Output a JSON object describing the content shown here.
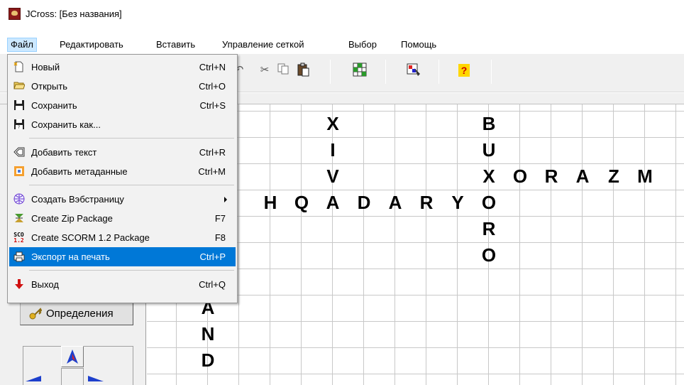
{
  "window": {
    "title": "JCross: [Без названия]"
  },
  "menubar": {
    "items": [
      {
        "label": "Файл"
      },
      {
        "label": "Редактировать"
      },
      {
        "label": "Вставить"
      },
      {
        "label": "Управление сеткой"
      },
      {
        "label": "Выбор"
      },
      {
        "label": "Помощь"
      }
    ]
  },
  "file_menu": {
    "items": [
      {
        "label": "Новый",
        "shortcut": "Ctrl+N",
        "icon": "new-document-icon"
      },
      {
        "label": "Открыть",
        "shortcut": "Ctrl+O",
        "icon": "folder-open-icon"
      },
      {
        "label": "Сохранить",
        "shortcut": "Ctrl+S",
        "icon": "floppy-disk-icon"
      },
      {
        "label": "Сохранить как...",
        "shortcut": "",
        "icon": "save-as-icon"
      },
      {
        "label": "Добавить текст",
        "shortcut": "Ctrl+R",
        "icon": "text-tag-icon"
      },
      {
        "label": "Добавить метаданные",
        "shortcut": "Ctrl+M",
        "icon": "metadata-icon"
      },
      {
        "label": "Создать Вэбстраницу",
        "shortcut": "",
        "icon": "web-page-icon"
      },
      {
        "label": "Create Zip Package",
        "shortcut": "F7",
        "icon": "zip-package-icon"
      },
      {
        "label": "Create SCORM 1.2 Package",
        "shortcut": "F8",
        "icon": "scorm-icon"
      },
      {
        "label": "Экспорт на печать",
        "shortcut": "Ctrl+P",
        "icon": "printer-icon"
      },
      {
        "label": "Выход",
        "shortcut": "Ctrl+Q",
        "icon": "exit-arrow-icon"
      }
    ],
    "scorm_badge_top": "SCO",
    "scorm_badge_bottom": "1.2"
  },
  "left_panel": {
    "definitions_button": "Определения"
  },
  "crossword": {
    "letters": [
      {
        "ch": "X",
        "col": 5,
        "row": 0
      },
      {
        "ch": "I",
        "col": 5,
        "row": 1
      },
      {
        "ch": "V",
        "col": 5,
        "row": 2
      },
      {
        "ch": "B",
        "col": 10,
        "row": 0
      },
      {
        "ch": "U",
        "col": 10,
        "row": 1
      },
      {
        "ch": "X",
        "col": 10,
        "row": 2
      },
      {
        "ch": "O",
        "col": 11,
        "row": 2
      },
      {
        "ch": "R",
        "col": 12,
        "row": 2
      },
      {
        "ch": "A",
        "col": 13,
        "row": 2
      },
      {
        "ch": "Z",
        "col": 14,
        "row": 2
      },
      {
        "ch": "M",
        "col": 15,
        "row": 2
      },
      {
        "ch": "H",
        "col": 3,
        "row": 3
      },
      {
        "ch": "Q",
        "col": 4,
        "row": 3
      },
      {
        "ch": "A",
        "col": 5,
        "row": 3
      },
      {
        "ch": "D",
        "col": 6,
        "row": 3
      },
      {
        "ch": "A",
        "col": 7,
        "row": 3
      },
      {
        "ch": "R",
        "col": 8,
        "row": 3
      },
      {
        "ch": "Y",
        "col": 9,
        "row": 3
      },
      {
        "ch": "O",
        "col": 10,
        "row": 3
      },
      {
        "ch": "R",
        "col": 10,
        "row": 4
      },
      {
        "ch": "O",
        "col": 10,
        "row": 5
      },
      {
        "ch": "A",
        "col": 1,
        "row": 7
      },
      {
        "ch": "N",
        "col": 1,
        "row": 8
      },
      {
        "ch": "D",
        "col": 1,
        "row": 9
      }
    ]
  }
}
